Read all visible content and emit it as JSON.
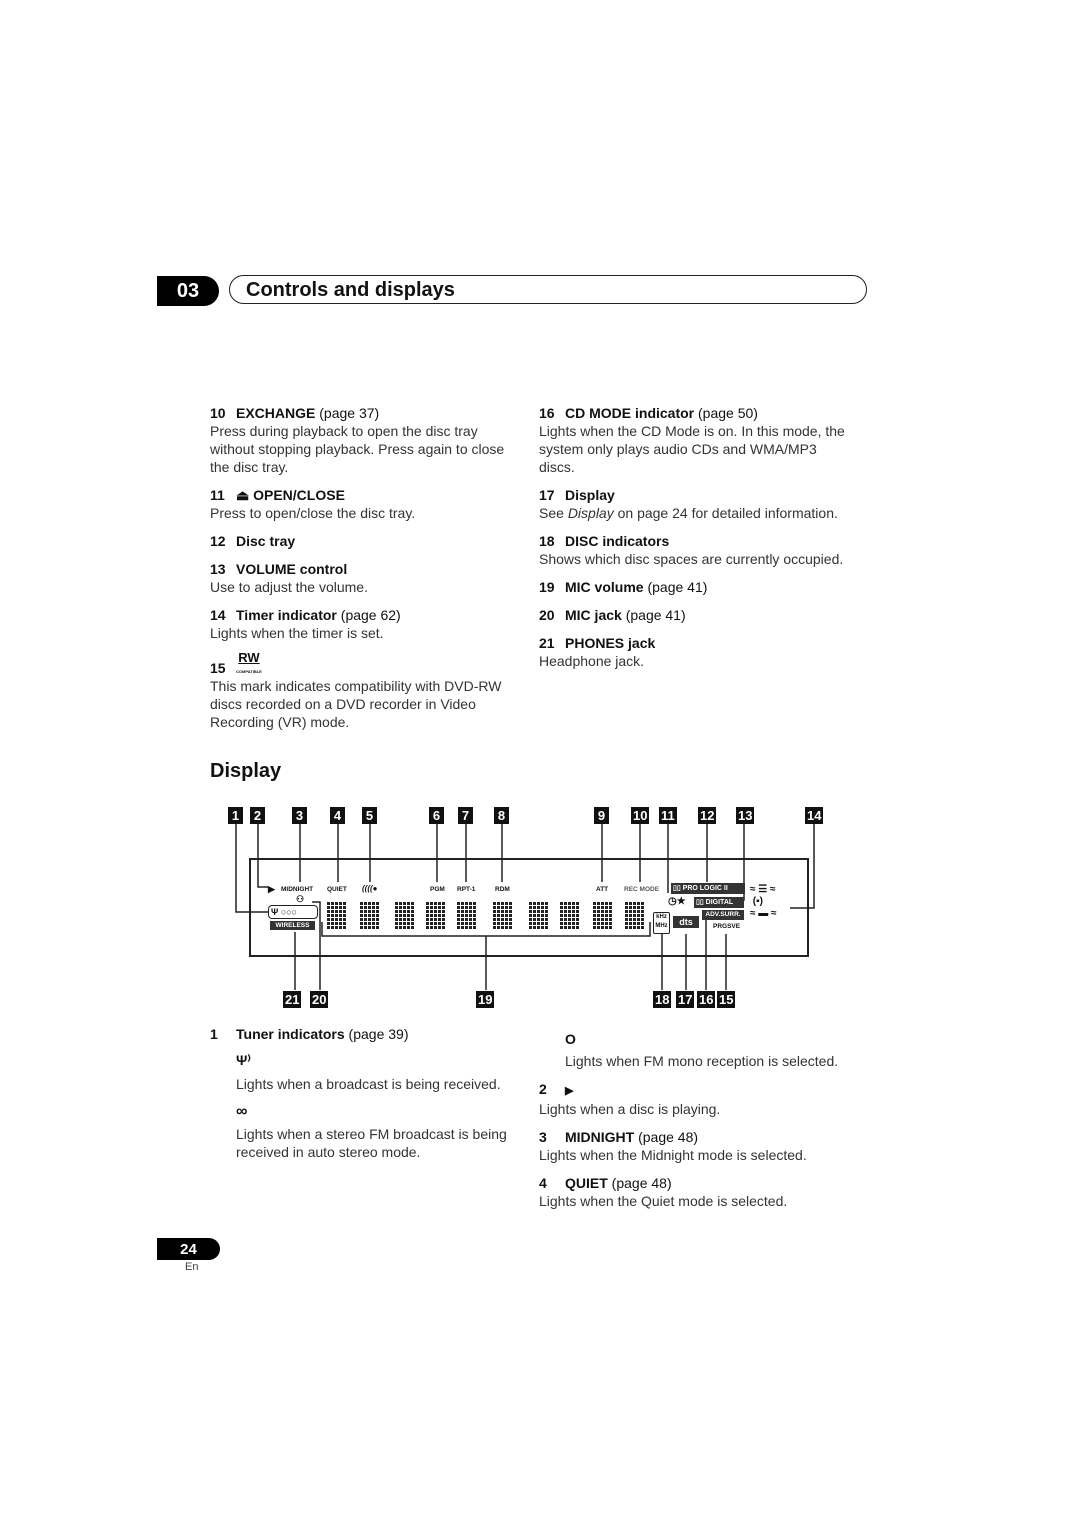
{
  "header": {
    "chapter": "03",
    "title": "Controls and displays"
  },
  "left_column": [
    {
      "num": "10",
      "label": "EXCHANGE",
      "page": "(page 37)",
      "desc": "Press during playback to open the disc tray without stopping playback. Press again to close the disc tray."
    },
    {
      "num": "11",
      "icon": "eject-icon",
      "label": "⏏ OPEN/CLOSE",
      "page": "",
      "desc": "Press to open/close the disc tray."
    },
    {
      "num": "12",
      "label": "Disc tray",
      "page": "",
      "desc": ""
    },
    {
      "num": "13",
      "label": "VOLUME control",
      "page": "",
      "desc": "Use to adjust the volume."
    },
    {
      "num": "14",
      "label": "Timer indicator",
      "page": "(page 62)",
      "desc": "Lights when the timer is set."
    },
    {
      "num": "15",
      "label": "RW",
      "sublabel": "COMPATIBLE",
      "page": "",
      "desc": "This mark indicates compatibility with DVD-RW discs recorded on a DVD recorder in Video Recording (VR) mode."
    }
  ],
  "right_column": [
    {
      "num": "16",
      "label": "CD MODE indicator",
      "page": "(page 50)",
      "desc": "Lights when the CD Mode is on. In this mode, the system only plays audio CDs and WMA/MP3 discs."
    },
    {
      "num": "17",
      "label": "Display",
      "page": "",
      "desc_pre": "See ",
      "desc_em": "Display",
      "desc_post": " on page 24 for detailed information."
    },
    {
      "num": "18",
      "label": "DISC indicators",
      "page": "",
      "desc": "Shows which disc spaces are currently occupied."
    },
    {
      "num": "19",
      "label": "MIC volume",
      "page": "(page 41)",
      "desc": ""
    },
    {
      "num": "20",
      "label": "MIC jack",
      "page": "(page 41)",
      "desc": ""
    },
    {
      "num": "21",
      "label": "PHONES jack",
      "page": "",
      "desc": "Headphone jack."
    }
  ],
  "display_section": {
    "title": "Display",
    "top_callouts": [
      "1",
      "2",
      "3",
      "4",
      "5",
      "6",
      "7",
      "8",
      "9",
      "10",
      "11",
      "12",
      "13",
      "14"
    ],
    "bottom_callouts": [
      "21",
      "20",
      "19",
      "18",
      "17",
      "16",
      "15"
    ],
    "lcd_labels": {
      "midnight": "MIDNIGHT",
      "quiet": "QUIET",
      "pgm": "PGM",
      "rpt": "RPT-1",
      "rdm": "RDM",
      "att": "ATT",
      "rec_mode": "REC MODE",
      "pro_logic": "PRO LOGIC",
      "pro_logic_ii": "II",
      "digital": "DIGITAL",
      "adv_surr": "ADV.SURR.",
      "prgsve": "PRGSVE",
      "wireless": "WIRELESS",
      "khz": "kHz",
      "mhz": "MHz",
      "dts": "dts"
    }
  },
  "display_items_left": [
    {
      "num": "1",
      "label": "Tuner indicators",
      "page": "(page 39)"
    },
    {
      "symbol": "Ψ⁾",
      "icon": "antenna-icon",
      "desc": "Lights when a broadcast is being received."
    },
    {
      "symbol": "∞",
      "icon": "stereo-icon",
      "desc": "Lights when a stereo FM broadcast is being received in auto stereo mode."
    }
  ],
  "display_items_right": [
    {
      "symbol": "O",
      "icon": "mono-icon",
      "desc": "Lights when FM mono reception is selected."
    },
    {
      "num": "2",
      "symbol": "▶",
      "desc": "Lights when a disc is playing."
    },
    {
      "num": "3",
      "label": "MIDNIGHT",
      "page": "(page 48)",
      "desc": "Lights when the Midnight mode is selected."
    },
    {
      "num": "4",
      "label": "QUIET",
      "page": "(page 48)",
      "desc": "Lights when the Quiet mode is selected."
    }
  ],
  "footer": {
    "page": "24",
    "lang": "En"
  }
}
